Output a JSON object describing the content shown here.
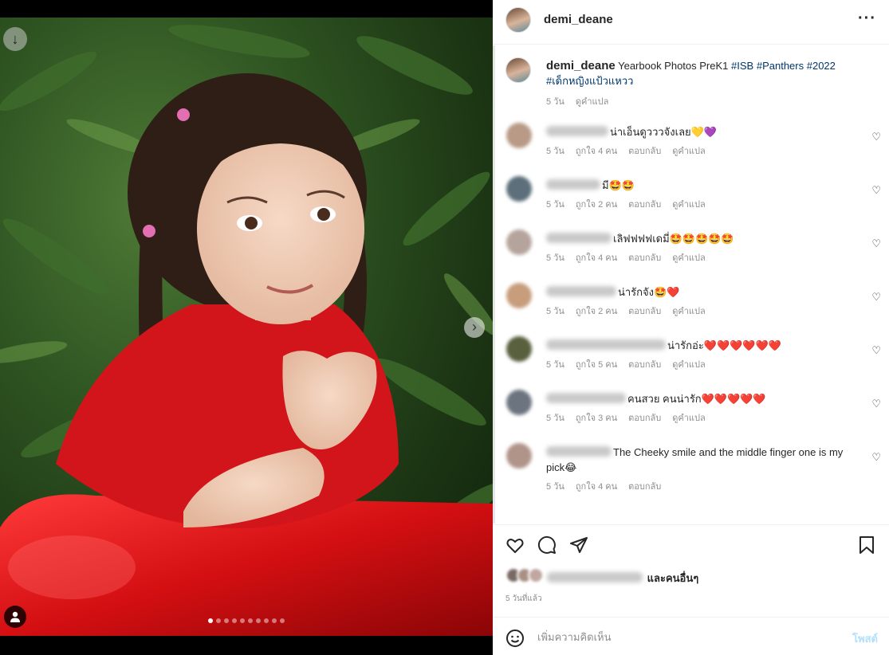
{
  "post": {
    "username": "demi_deane",
    "caption_prefix": "Yearbook Photos PreK1",
    "tags": [
      "#ISB",
      "#Panthers",
      "#2022",
      "#เด็กหญิงแป้วแหวว"
    ],
    "caption_time": "5 วัน",
    "translate_label": "ดูคำแปล"
  },
  "carousel": {
    "count": 10,
    "active_index": 0
  },
  "comments": [
    {
      "text": "น่าเอ็นดูวววจังเลย💛💜",
      "time": "5 วัน",
      "likes": "ถูกใจ 4 คน",
      "reply": "ตอบกลับ",
      "translate": "ดูคำแปล",
      "avatar_color": "#b89a86"
    },
    {
      "text": "มี🤩🤩",
      "time": "5 วัน",
      "likes": "ถูกใจ 2 คน",
      "reply": "ตอบกลับ",
      "translate": "ดูคำแปล",
      "avatar_color": "#5c6f7a"
    },
    {
      "text": "เลิฟฟฟฟเดมี่🤩🤩🤩🤩🤩",
      "time": "5 วัน",
      "likes": "ถูกใจ 4 คน",
      "reply": "ตอบกลับ",
      "translate": "ดูคำแปล",
      "avatar_color": "#b5a49c"
    },
    {
      "text": "น่ารักจัง🤩❤️",
      "time": "5 วัน",
      "likes": "ถูกใจ 2 คน",
      "reply": "ตอบกลับ",
      "translate": "ดูคำแปล",
      "avatar_color": "#c79d7c"
    },
    {
      "text": "น่ารักอ่ะ❤️❤️❤️❤️❤️❤️",
      "time": "5 วัน",
      "likes": "ถูกใจ 5 คน",
      "reply": "ตอบกลับ",
      "translate": "ดูคำแปล",
      "avatar_color": "#58603e"
    },
    {
      "text": "คนสวย คนน่ารัก❤️❤️❤️❤️❤️",
      "time": "5 วัน",
      "likes": "ถูกใจ 3 คน",
      "reply": "ตอบกลับ",
      "translate": "ดูคำแปล",
      "avatar_color": "#6c7480"
    },
    {
      "text": "The Cheeky smile and the middle finger one is my pick😂",
      "time": "5 วัน",
      "likes": "ถูกใจ 4 คน",
      "reply": "ตอบกลับ",
      "translate": "",
      "avatar_color": "#b0948a"
    }
  ],
  "likes_text": "และคนอื่นๆ",
  "time_ago": "5 วันที่แล้ว",
  "composer": {
    "placeholder": "เพิ่มความคิดเห็น",
    "post_label": "โพสต์"
  }
}
